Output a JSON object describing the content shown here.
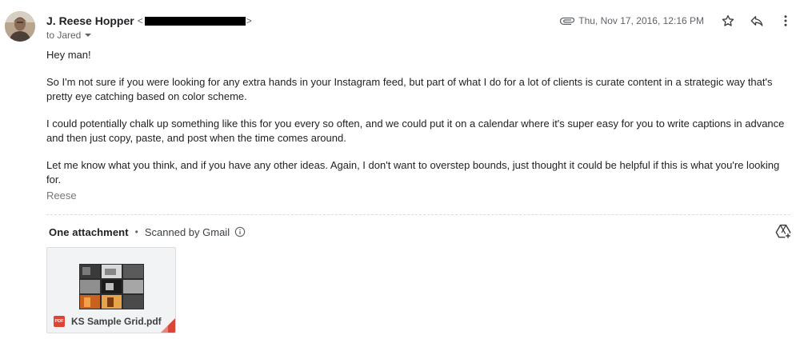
{
  "sender": {
    "name": "J. Reese Hopper",
    "email_prefix": "<",
    "email_suffix": ">"
  },
  "recipient": {
    "label": "to Jared"
  },
  "header": {
    "date": "Thu, Nov 17, 2016, 12:16 PM",
    "icons": [
      "paperclip-icon",
      "star-icon",
      "reply-icon",
      "more-vert-icon"
    ]
  },
  "message": {
    "greeting": "Hey man!",
    "paragraphs": [
      "So I'm not sure if you were looking for any extra hands in your Instagram feed, but part of what I do for a lot of clients is curate content in a strategic way that's pretty eye catching based on color scheme.",
      "I could potentially chalk up something like this for you every so often, and we could put it on a calendar where it's super easy for you to write captions in advance and then just copy, paste, and post when the time comes around.",
      "Let me know what you think, and if you have any other ideas. Again, I don't want to overstep bounds, just thought it could be helpful if this is what you're looking for."
    ],
    "signature": "Reese"
  },
  "attachments": {
    "count_label": "One attachment",
    "separator": "•",
    "scanned_label": "Scanned by Gmail",
    "files": [
      {
        "name": "KS Sample Grid.pdf",
        "type_badge": "PDF"
      }
    ]
  },
  "colors": {
    "pdf_red": "#db4437",
    "text_primary": "#202124",
    "text_secondary": "#5f6368",
    "redaction": "#000000"
  }
}
